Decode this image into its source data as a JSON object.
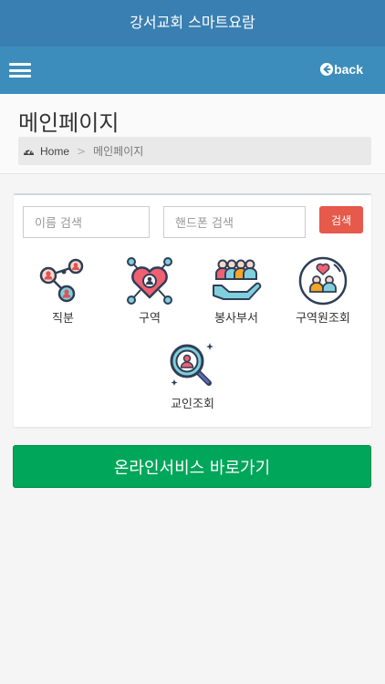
{
  "app": {
    "title": "강서교회 스마트요람"
  },
  "nav": {
    "back_label": "back"
  },
  "header": {
    "page_title": "메인페이지",
    "breadcrumb": {
      "home": "Home",
      "separator": ">",
      "current": "메인페이지"
    }
  },
  "search": {
    "name_placeholder": "이름 검색",
    "phone_placeholder": "핸드폰 검색",
    "button_label": "검색"
  },
  "menu": {
    "items": [
      {
        "label": "직분",
        "icon": "position-network-icon"
      },
      {
        "label": "구역",
        "icon": "district-heart-icon"
      },
      {
        "label": "봉사부서",
        "icon": "volunteer-hand-icon"
      },
      {
        "label": "구역원조회",
        "icon": "district-members-icon"
      },
      {
        "label": "교인조회",
        "icon": "member-search-icon"
      }
    ]
  },
  "online_button": {
    "label": "온라인서비스 바로가기"
  },
  "colors": {
    "titlebar": "#3a7fb1",
    "navbar": "#3c8dbc",
    "search_button": "#e55a4b",
    "online_button": "#00a65a"
  }
}
